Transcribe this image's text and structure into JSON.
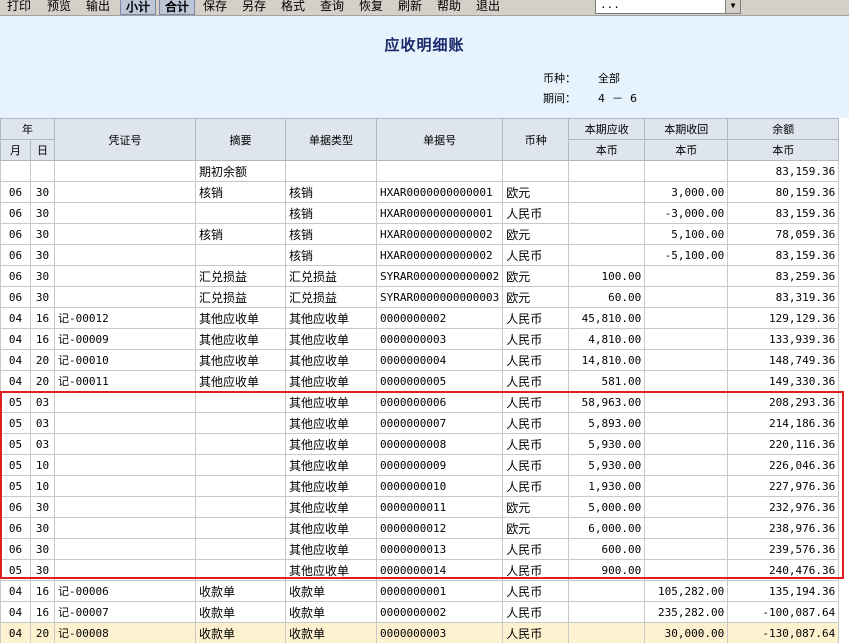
{
  "toolbar": {
    "buttons": [
      "打印",
      "预览",
      "输出",
      "小计",
      "合计",
      "保存",
      "另存",
      "格式",
      "查询",
      "恢复",
      "刷新",
      "帮助",
      "退出"
    ],
    "combo_value": "...",
    "combo_arrow": "▼"
  },
  "report": {
    "title": "应收明细账",
    "currency_label": "币种：",
    "currency_value": "全部",
    "period_label": "期间：",
    "period_value": "4  －  6"
  },
  "columns": {
    "year": "年",
    "month": "月",
    "day": "日",
    "voucher": "凭证号",
    "summary": "摘要",
    "doc_type": "单据类型",
    "doc_no": "单据号",
    "currency": "币种",
    "receivable": "本期应收",
    "received": "本期收回",
    "balance": "余额",
    "sub_local": "本币"
  },
  "rows": [
    [
      "",
      "",
      "",
      "期初余额",
      "",
      "",
      "",
      "",
      "",
      "83,159.36"
    ],
    [
      "06",
      "30",
      "",
      "核销",
      "核销",
      "HXAR0000000000001",
      "欧元",
      "",
      "3,000.00",
      "80,159.36"
    ],
    [
      "06",
      "30",
      "",
      "",
      "核销",
      "HXAR0000000000001",
      "人民币",
      "",
      "-3,000.00",
      "83,159.36"
    ],
    [
      "06",
      "30",
      "",
      "核销",
      "核销",
      "HXAR0000000000002",
      "欧元",
      "",
      "5,100.00",
      "78,059.36"
    ],
    [
      "06",
      "30",
      "",
      "",
      "核销",
      "HXAR0000000000002",
      "人民币",
      "",
      "-5,100.00",
      "83,159.36"
    ],
    [
      "06",
      "30",
      "",
      "汇兑损益",
      "汇兑损益",
      "SYRAR0000000000002",
      "欧元",
      "100.00",
      "",
      "83,259.36"
    ],
    [
      "06",
      "30",
      "",
      "汇兑损益",
      "汇兑损益",
      "SYRAR0000000000003",
      "欧元",
      "60.00",
      "",
      "83,319.36"
    ],
    [
      "04",
      "16",
      "记-00012",
      "其他应收单",
      "其他应收单",
      "0000000002",
      "人民币",
      "45,810.00",
      "",
      "129,129.36"
    ],
    [
      "04",
      "16",
      "记-00009",
      "其他应收单",
      "其他应收单",
      "0000000003",
      "人民币",
      "4,810.00",
      "",
      "133,939.36"
    ],
    [
      "04",
      "20",
      "记-00010",
      "其他应收单",
      "其他应收单",
      "0000000004",
      "人民币",
      "14,810.00",
      "",
      "148,749.36"
    ],
    [
      "04",
      "20",
      "记-00011",
      "其他应收单",
      "其他应收单",
      "0000000005",
      "人民币",
      "581.00",
      "",
      "149,330.36"
    ],
    [
      "05",
      "03",
      "",
      "",
      "其他应收单",
      "0000000006",
      "人民币",
      "58,963.00",
      "",
      "208,293.36"
    ],
    [
      "05",
      "03",
      "",
      "",
      "其他应收单",
      "0000000007",
      "人民币",
      "5,893.00",
      "",
      "214,186.36"
    ],
    [
      "05",
      "03",
      "",
      "",
      "其他应收单",
      "0000000008",
      "人民币",
      "5,930.00",
      "",
      "220,116.36"
    ],
    [
      "05",
      "10",
      "",
      "",
      "其他应收单",
      "0000000009",
      "人民币",
      "5,930.00",
      "",
      "226,046.36"
    ],
    [
      "05",
      "10",
      "",
      "",
      "其他应收单",
      "0000000010",
      "人民币",
      "1,930.00",
      "",
      "227,976.36"
    ],
    [
      "06",
      "30",
      "",
      "",
      "其他应收单",
      "0000000011",
      "欧元",
      "5,000.00",
      "",
      "232,976.36"
    ],
    [
      "06",
      "30",
      "",
      "",
      "其他应收单",
      "0000000012",
      "欧元",
      "6,000.00",
      "",
      "238,976.36"
    ],
    [
      "06",
      "30",
      "",
      "",
      "其他应收单",
      "0000000013",
      "人民币",
      "600.00",
      "",
      "239,576.36"
    ],
    [
      "05",
      "30",
      "",
      "",
      "其他应收单",
      "0000000014",
      "人民币",
      "900.00",
      "",
      "240,476.36"
    ],
    [
      "04",
      "16",
      "记-00006",
      "收款单",
      "收款单",
      "0000000001",
      "人民币",
      "",
      "105,282.00",
      "135,194.36"
    ],
    [
      "04",
      "16",
      "记-00007",
      "收款单",
      "收款单",
      "0000000002",
      "人民币",
      "",
      "235,282.00",
      "-100,087.64"
    ],
    [
      "04",
      "20",
      "记-00008",
      "收款单",
      "收款单",
      "0000000003",
      "人民币",
      "",
      "30,000.00",
      "-130,087.64"
    ]
  ],
  "colors": {
    "highlight_box": "#e02020",
    "selected_row": "#fdf1cf",
    "header_bg": "#e6f2fc"
  }
}
